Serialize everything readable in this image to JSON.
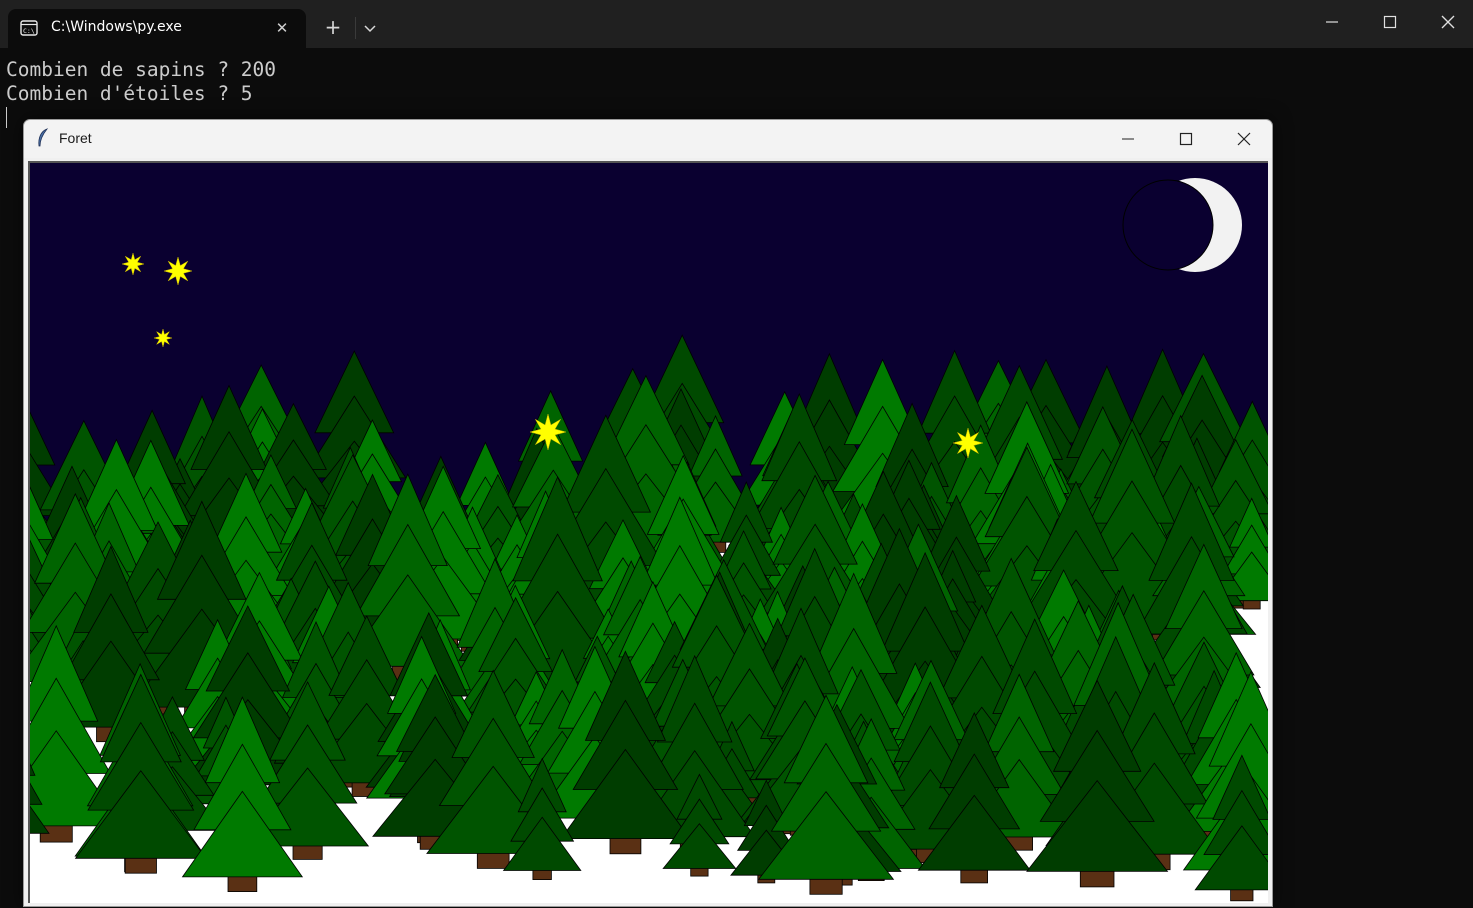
{
  "terminal": {
    "tab_title": "C:\\Windows\\py.exe",
    "tab_icon": "console-icon",
    "lines": [
      "Combien de sapins ? 200",
      "Combien d'étoiles ? 5"
    ],
    "colors": {
      "background": "#0c0c0c",
      "titlebar": "#202020",
      "text": "#cccccc"
    }
  },
  "tk_window": {
    "title": "Foret",
    "icon": "feather-icon",
    "colors": {
      "sky": "#0a0030",
      "snow": "#ffffff",
      "star": "#ffff00",
      "moon": "#f2f2f2",
      "trunk": "#5a3014",
      "tree_dark": "#003d00",
      "tree_mid": "#005400",
      "tree_light": "#007a00",
      "tree_outline": "#000000"
    },
    "scene": {
      "tree_count": 200,
      "star_count": 5
    }
  }
}
